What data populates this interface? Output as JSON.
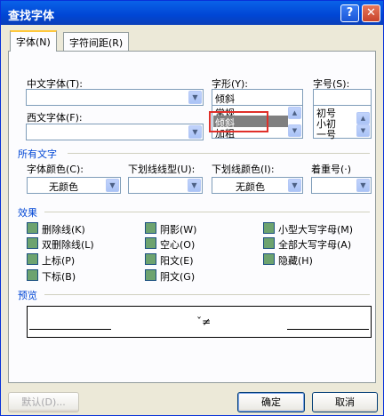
{
  "window": {
    "title": "查找字体",
    "help_label": "?",
    "close_label": "✕"
  },
  "tabs": [
    {
      "label": "字体(N)"
    },
    {
      "label": "字符间距(R)"
    }
  ],
  "font": {
    "cn_font_label": "中文字体(T):",
    "cn_font_value": "",
    "west_font_label": "西文字体(F):",
    "west_font_value": "",
    "style_label": "字形(Y):",
    "style_value": "倾斜",
    "style_options": [
      "常规",
      "倾斜",
      "加粗"
    ],
    "size_label": "字号(S):",
    "size_value": "",
    "size_options": [
      "初号",
      "小初",
      "一号"
    ]
  },
  "all_text": {
    "section_title": "所有文字",
    "font_color_label": "字体颜色(C):",
    "font_color_value": "无颜色",
    "underline_style_label": "下划线线型(U):",
    "underline_style_value": "",
    "underline_color_label": "下划线颜色(I):",
    "underline_color_value": "无颜色",
    "emphasis_label": "着重号(·)",
    "emphasis_value": ""
  },
  "effects": {
    "section_title": "效果",
    "items": [
      {
        "label": "删除线(K)"
      },
      {
        "label": "双删除线(L)"
      },
      {
        "label": "上标(P)"
      },
      {
        "label": "下标(B)"
      },
      {
        "label": "阴影(W)"
      },
      {
        "label": "空心(O)"
      },
      {
        "label": "阳文(E)"
      },
      {
        "label": "阴文(G)"
      },
      {
        "label": "小型大写字母(M)"
      },
      {
        "label": "全部大写字母(A)"
      },
      {
        "label": "隐藏(H)"
      }
    ]
  },
  "preview": {
    "section_title": "预览",
    "sample_text": "ˇ≠"
  },
  "buttons": {
    "default_label": "默认(D)...",
    "ok_label": "确定",
    "cancel_label": "取消"
  },
  "colors": {
    "titlebar": "#0a62e8",
    "section_title": "#0046d5",
    "highlight_box": "#e0302a",
    "selected_item": "#808080"
  }
}
